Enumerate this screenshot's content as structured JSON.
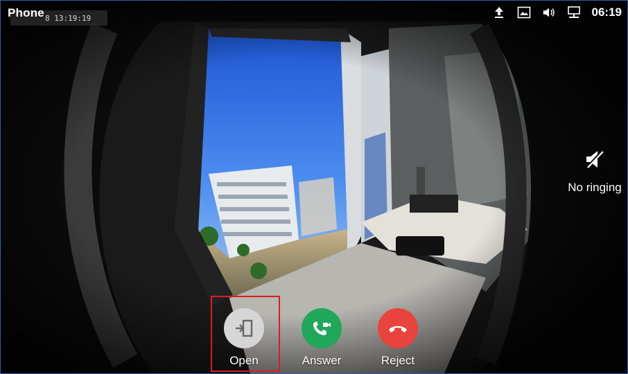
{
  "status_bar": {
    "app_title": "Phone",
    "camera_timestamp": "8 13:19:19",
    "time": "06:19",
    "icons": [
      "upload-icon",
      "screenshot-icon",
      "volume-icon",
      "network-icon"
    ]
  },
  "ringer": {
    "label": "No ringing",
    "icon": "mute-speaker-icon"
  },
  "actions": {
    "open": {
      "label": "Open",
      "icon": "door-open-icon",
      "color": "#d6d6d6"
    },
    "answer": {
      "label": "Answer",
      "icon": "video-call-icon",
      "color": "#1fa85a"
    },
    "reject": {
      "label": "Reject",
      "icon": "hang-up-icon",
      "color": "#e8433c"
    }
  },
  "highlight_color": "#e01b1b"
}
